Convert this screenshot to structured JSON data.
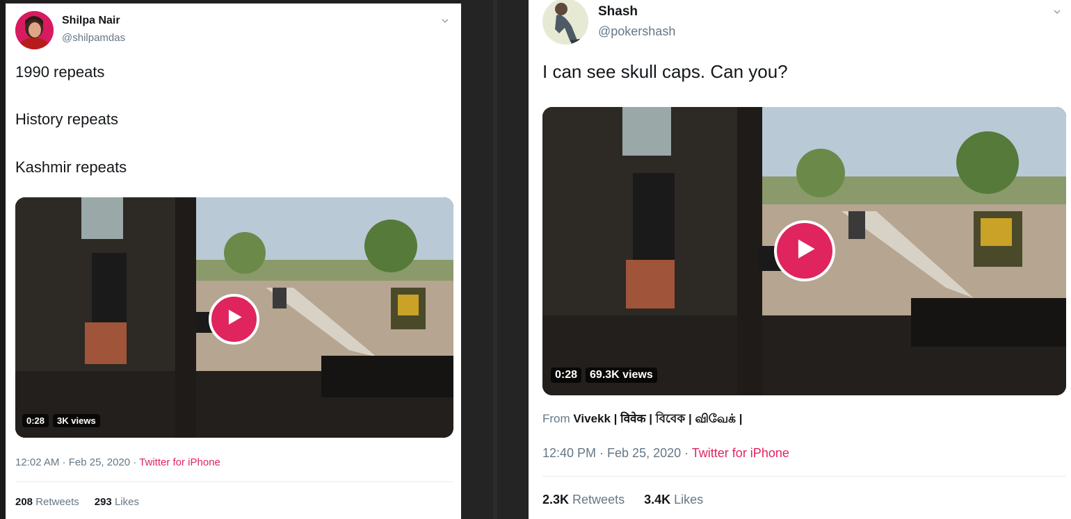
{
  "colors": {
    "accent": "#e0245e",
    "muted": "#657786",
    "text": "#14171a"
  },
  "left_tweet": {
    "author_name": "Shilpa Nair",
    "author_handle": "@shilpamdas",
    "text_lines": [
      "1990 repeats",
      "History repeats",
      "Kashmir repeats"
    ],
    "video": {
      "duration": "0:28",
      "views": "3K views",
      "icon": "play-icon"
    },
    "timestamp": "12:02 AM · Feb 25, 2020 · ",
    "source": "Twitter for iPhone",
    "retweets_count": "208",
    "retweets_label": "Retweets",
    "likes_count": "293",
    "likes_label": "Likes"
  },
  "right_tweet": {
    "author_name": "Shash",
    "author_handle": "@pokershash",
    "text": "I can see skull caps. Can you?",
    "video": {
      "duration": "0:28",
      "views": "69.3K views",
      "icon": "play-icon"
    },
    "from_prefix": "From ",
    "from_name": "Vivekk | विवेक | বিবেক | விவேக் |",
    "timestamp": "12:40 PM · Feb 25, 2020 · ",
    "source": "Twitter for iPhone",
    "retweets_count": "2.3K",
    "retweets_label": "Retweets",
    "likes_count": "3.4K",
    "likes_label": "Likes"
  }
}
